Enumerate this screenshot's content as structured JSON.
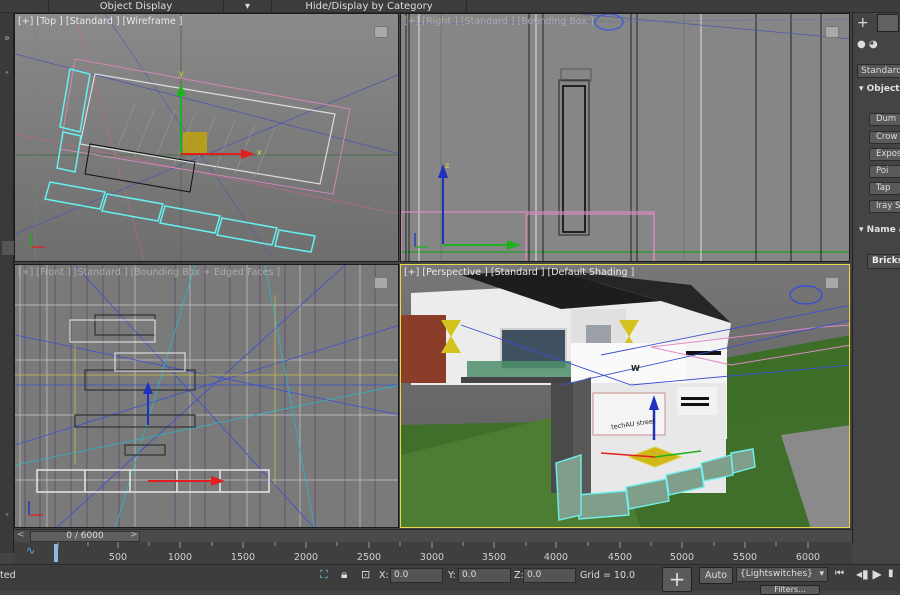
{
  "top_tabs": [
    "Object Display",
    "Hide/Display by Category"
  ],
  "viewports": {
    "top": "[+] [Top ] [Standard ] [Wireframe ]",
    "right": "[+] [Right ] [Standard ] [Bounding Box ]",
    "front": "[+] [Front ] [Standard ] [Bounding Box + Edged Faces ]",
    "perspective": "[+] [Perspective ] [Standard ] [Default Shading ]"
  },
  "scene_text": {
    "mailbox_letter": "W",
    "sign": "techAU street"
  },
  "axis_labels": {
    "x": "x",
    "y": "y",
    "z": "z"
  },
  "command_panel": {
    "dropdown": "Standard",
    "rollout_object_type": "Object",
    "buttons": [
      "Dum",
      "Crow",
      "Expos",
      "Poi",
      "Tap",
      "Iray Se"
    ],
    "rollout_name": "Name a",
    "name_value": "Bricks"
  },
  "timeline": {
    "frame": "0 / 6000",
    "ticks": [
      "500",
      "1000",
      "1500",
      "2000",
      "2500",
      "3000",
      "3500",
      "4000",
      "4500",
      "5000",
      "5500",
      "6000"
    ]
  },
  "status": {
    "left_text": "ted",
    "x_label": "X:",
    "x_value": "0.0",
    "y_label": "Y:",
    "y_value": "0.0",
    "z_label": "Z:",
    "z_value": "0.0",
    "grid": "Grid = 10.0",
    "auto": "Auto",
    "selection_set": "{Lightswitches}",
    "filters": "Filters..."
  }
}
